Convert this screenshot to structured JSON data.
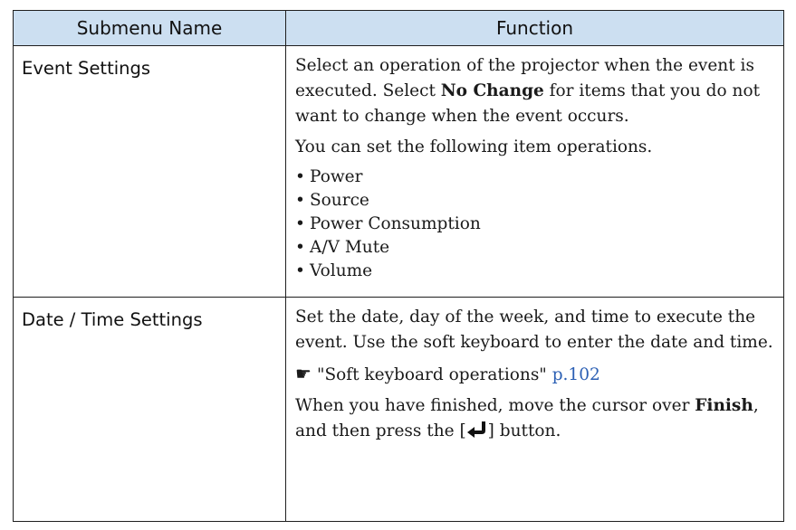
{
  "header": {
    "col1": "Submenu Name",
    "col2": "Function"
  },
  "rows": [
    {
      "name": "Event Settings",
      "p1_before": "Select an operation of the projector when the event is executed. Select ",
      "p1_bold": "No Change",
      "p1_after": " for items that you do not want to change when the event occurs.",
      "p2": "You can set the following item operations.",
      "items": [
        "Power",
        "Source",
        "Power Consumption",
        "A/V Mute",
        "Volume"
      ]
    },
    {
      "name": "Date / Time Settings",
      "p1": "Set the date, day of the week, and time to execute the event. Use the soft keyboard to enter the date and time.",
      "link_icon": "pointing-hand-icon",
      "link_text": "\"Soft keyboard operations\" ",
      "link_page": "p.102",
      "p3_before": "When you have finished, move the cursor over ",
      "p3_bold": "Finish",
      "p3_middle": ", and then press the [",
      "enter_icon": "enter-key-icon",
      "p3_after": "] button."
    }
  ],
  "colors": {
    "header_bg": "#ccdff1",
    "border": "#1f1f1f",
    "link": "#2b5fb4"
  }
}
